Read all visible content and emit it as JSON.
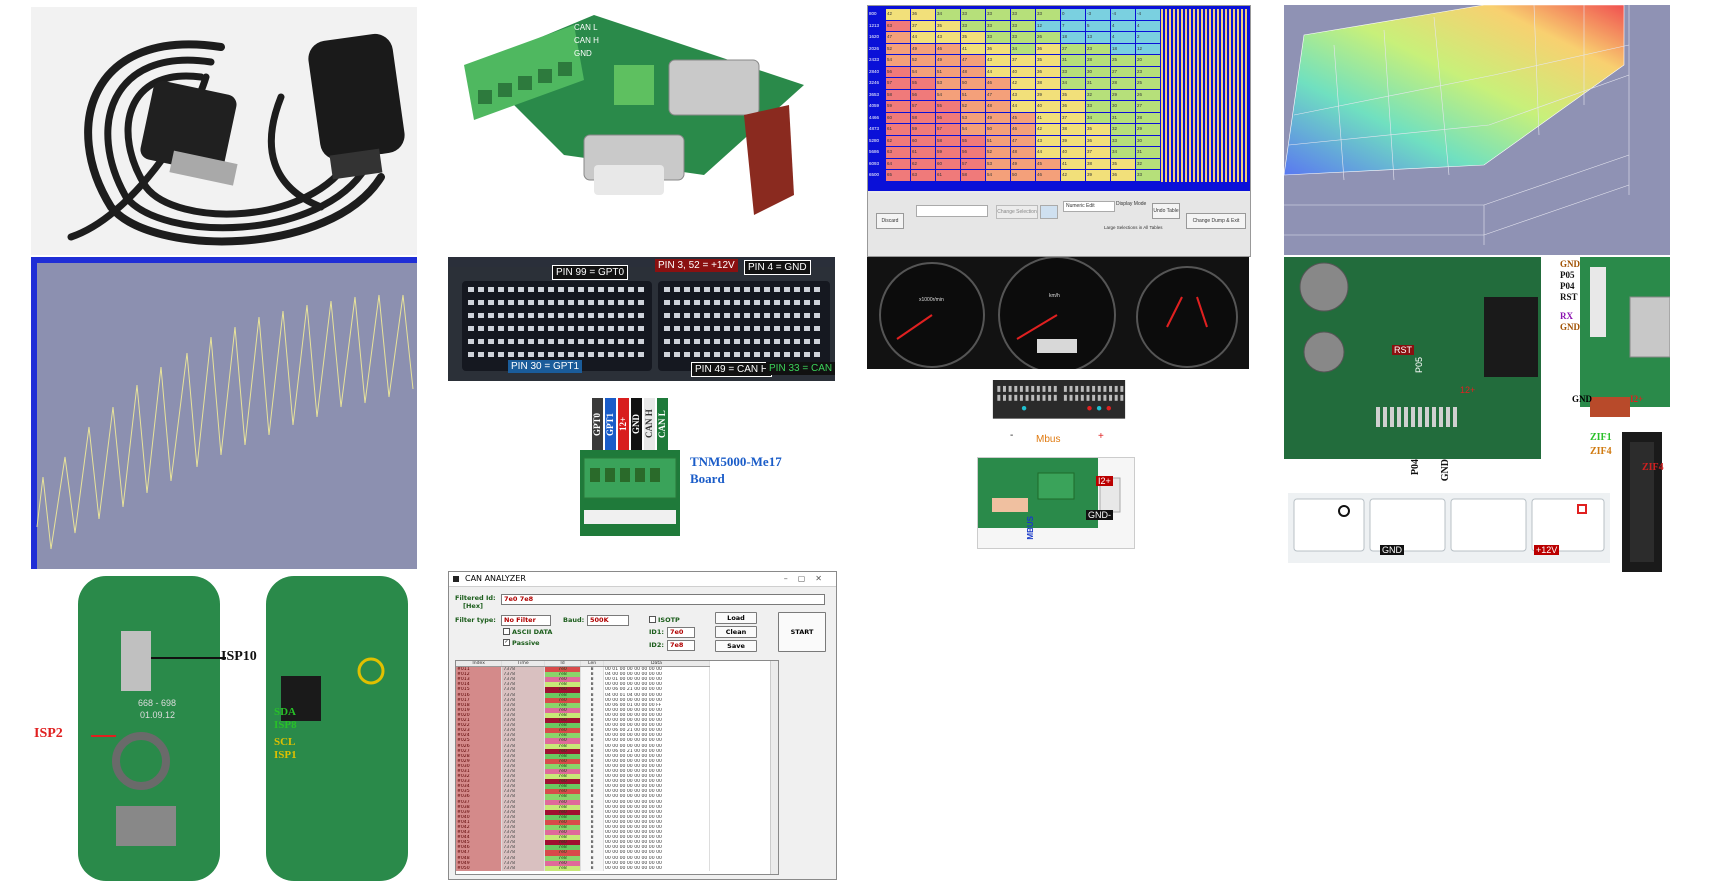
{
  "colors": {
    "pcb_green": "#1f7a3a",
    "terminal_green": "#3aa35a",
    "oscilloscope_bg": "#8c90b0",
    "oscilloscope_frame": "#1f2ed6",
    "oscilloscope_trace": "#e8e39a",
    "map_blue": "#0a10d8",
    "table_red": "#f07a7a",
    "table_yellow": "#f2e07a",
    "table_green": "#b6e07a",
    "accent_red": "#e02020",
    "accent_blue": "#1a5cc8"
  },
  "obd_cable": {
    "icon": "obd-cable-photo-icon"
  },
  "adapter_board": {
    "icon": "obd-db15-adapter-board-photo-icon"
  },
  "ecu_pinout": {
    "labels": {
      "gpt0": "PIN 99 = GPT0",
      "v12": "PIN 3, 52 = +12V",
      "gnd": "PIN 4 = GND",
      "gpt1": "PIN 30 = GPT1",
      "canh": "PIN 49 = CAN H",
      "canl": "PIN 33 = CAN L"
    }
  },
  "terminal_board": {
    "wires": [
      "GPT0",
      "GPT1",
      "12+",
      "GND",
      "CAN H",
      "CAN L"
    ],
    "caption_line1": "TNM5000-Me17",
    "caption_line2": "Board"
  },
  "map_table": {
    "row_headers": [
      "800",
      "1213",
      "1620",
      "2026",
      "2433",
      "2840",
      "3246",
      "3653",
      "4059",
      "4466",
      "4873",
      "5280",
      "5686",
      "6093",
      "6500"
    ],
    "rows": [
      [
        42,
        36,
        34,
        33,
        33,
        33,
        33,
        0,
        -3,
        -4,
        -4
      ],
      [
        63,
        37,
        35,
        33,
        33,
        33,
        12,
        7,
        5,
        4,
        4
      ],
      [
        47,
        44,
        43,
        35,
        33,
        33,
        26,
        18,
        13,
        4,
        2
      ],
      [
        52,
        49,
        46,
        41,
        36,
        34,
        36,
        27,
        23,
        18,
        12
      ],
      [
        54,
        52,
        49,
        47,
        43,
        37,
        35,
        31,
        28,
        25,
        20
      ],
      [
        56,
        54,
        51,
        48,
        44,
        40,
        36,
        33,
        30,
        27,
        23
      ],
      [
        57,
        55,
        53,
        50,
        46,
        42,
        38,
        34,
        31,
        28,
        25
      ],
      [
        58,
        56,
        54,
        51,
        47,
        43,
        39,
        35,
        32,
        29,
        26
      ],
      [
        59,
        57,
        55,
        52,
        48,
        44,
        40,
        36,
        33,
        30,
        27
      ],
      [
        60,
        58,
        56,
        53,
        49,
        45,
        41,
        37,
        34,
        31,
        28
      ],
      [
        61,
        59,
        57,
        54,
        50,
        46,
        42,
        38,
        35,
        32,
        29
      ],
      [
        62,
        60,
        58,
        55,
        51,
        47,
        43,
        39,
        36,
        33,
        30
      ],
      [
        63,
        61,
        59,
        56,
        52,
        48,
        44,
        40,
        37,
        34,
        31
      ],
      [
        64,
        62,
        60,
        57,
        53,
        49,
        45,
        41,
        38,
        35,
        32
      ],
      [
        65,
        63,
        61,
        58,
        54,
        50,
        46,
        42,
        39,
        36,
        33
      ]
    ],
    "toolbar": {
      "discard": "Discard",
      "change_selection": "Change Selection",
      "edit_mode": "Numeric Edit",
      "display_mode": "Display Mode",
      "undo": "Undo Table",
      "change_dump": "Change Dump & Exit",
      "selections_note": "Large Selections in All Tables"
    }
  },
  "map_3d": {
    "icon": "3d-fuel-map-surface-icon"
  },
  "oscilloscope": {
    "icon": "oscilloscope-sawtooth-trace-icon"
  },
  "instrument_cluster": {
    "icon": "instrument-cluster-gauges-icon",
    "tach_label": "x1000r/min",
    "speedo_label": "km/h",
    "tach_ticks": [
      "0",
      "1",
      "2",
      "3",
      "4",
      "5",
      "6",
      "7",
      "8"
    ],
    "speed_ticks": [
      "0",
      "20",
      "40",
      "60",
      "80",
      "100",
      "120",
      "140",
      "160"
    ]
  },
  "cluster_connector": {
    "mbus": "Mbus",
    "minus": "-",
    "plus": "+"
  },
  "cluster_board": {
    "i2_plus": "I2+",
    "gnd_minus": "GND-",
    "mbus": "MBUS"
  },
  "ecu_board_zif": {
    "pins_right": [
      "GND",
      "P05",
      "P04",
      "RST",
      "RX",
      "GND"
    ],
    "gnd": "GND",
    "i2plus": "I2+",
    "zif1": "ZIF1",
    "zif4_a": "ZIF4",
    "zif4_b": "ZIF4",
    "rst": "RST",
    "pos": "P05",
    "p04": "P04",
    "plus12": "12+",
    "connector_gnd": "GND",
    "connector_12v": "+12V"
  },
  "key_pcb": {
    "isp10": "ISP10",
    "isp2": "ISP2",
    "isp_labels": [
      "SDA",
      "ISP8",
      "SCL",
      "ISP1"
    ],
    "code": "668 - 698",
    "date": "01.09.12"
  },
  "can_analyzer": {
    "title": "CAN ANALYZER",
    "filtered_id_label": "Filtered Id:",
    "hex_label": "[Hex]",
    "filtered_id_value": "7e0 7e8",
    "filter_type_label": "Filter type:",
    "filter_type_value": "No Filter",
    "baud_label": "Baud:",
    "baud_value": "500K",
    "isotp": "ISOTP",
    "ascii": "ASCII DATA",
    "passive": "Passive",
    "id1_label": "ID1:",
    "id1_value": "7e0",
    "id2_label": "ID2:",
    "id2_value": "7e8",
    "load": "Load",
    "clean": "Clean",
    "save": "Save",
    "start": "START",
    "columns": [
      "Index",
      "Time",
      "Id",
      "Len",
      "Data"
    ],
    "rows": [
      [
        "#011",
        "7378",
        "7e0",
        "8",
        "00 01 00 00 00 00 00 00"
      ],
      [
        "#012",
        "7378",
        "7e8",
        "8",
        "04 00 00 00 00 00 00 00"
      ],
      [
        "#013",
        "7378",
        "7e0",
        "8",
        "00 01 00 00 00 00 00 00"
      ],
      [
        "#014",
        "7378",
        "7e8",
        "8",
        "00 00 00 00 00 00 00 00"
      ],
      [
        "#015",
        "7378",
        "7e0",
        "8",
        "00 06 00 21 00 00 00 00"
      ],
      [
        "#016",
        "7378",
        "7e8",
        "8",
        "04 00 01 04 00 00 00 00"
      ],
      [
        "#017",
        "7378",
        "7e0",
        "8",
        "00 00 00 00 00 00 00 00"
      ],
      [
        "#018",
        "7378",
        "7e8",
        "8",
        "00 06 00 01 00 00 00 FF"
      ],
      [
        "#019",
        "7378",
        "7e0",
        "8",
        "00 00 00 00 00 00 00 00"
      ],
      [
        "#020",
        "7378",
        "7e8",
        "8",
        "00 00 00 00 00 00 00 00"
      ],
      [
        "#021",
        "7378",
        "7e0",
        "8",
        "00 00 00 00 00 00 00 00"
      ],
      [
        "#022",
        "7378",
        "7e8",
        "8",
        "00 00 00 00 00 00 00 00"
      ],
      [
        "#023",
        "7378",
        "7e0",
        "8",
        "00 06 00 21 00 00 00 00"
      ],
      [
        "#024",
        "7378",
        "7e8",
        "8",
        "00 00 00 00 00 00 00 00"
      ],
      [
        "#025",
        "7378",
        "7e0",
        "8",
        "00 00 00 00 00 00 00 00"
      ],
      [
        "#026",
        "7378",
        "7e8",
        "8",
        "00 00 00 00 00 00 00 00"
      ],
      [
        "#027",
        "7378",
        "7e0",
        "8",
        "00 06 00 21 00 00 00 00"
      ],
      [
        "#028",
        "7378",
        "7e8",
        "8",
        "00 00 00 00 00 00 00 00"
      ],
      [
        "#029",
        "7378",
        "7e0",
        "8",
        "00 00 00 00 00 00 00 00"
      ],
      [
        "#030",
        "7378",
        "7e8",
        "8",
        "00 00 00 00 00 00 00 00"
      ],
      [
        "#031",
        "7378",
        "7e0",
        "8",
        "00 00 00 00 00 00 00 00"
      ],
      [
        "#032",
        "7378",
        "7e8",
        "8",
        "00 00 00 00 00 00 00 00"
      ],
      [
        "#033",
        "7378",
        "7e0",
        "8",
        "00 00 00 00 00 00 00 00"
      ],
      [
        "#034",
        "7378",
        "7e8",
        "8",
        "00 00 00 00 00 00 00 00"
      ],
      [
        "#035",
        "7378",
        "7e0",
        "8",
        "00 00 00 00 00 00 00 00"
      ],
      [
        "#036",
        "7378",
        "7e8",
        "8",
        "00 00 00 00 00 00 00 00"
      ],
      [
        "#037",
        "7378",
        "7e0",
        "8",
        "00 00 00 00 00 00 00 00"
      ],
      [
        "#038",
        "7378",
        "7e8",
        "8",
        "00 00 00 00 00 00 00 00"
      ],
      [
        "#039",
        "7378",
        "7e0",
        "8",
        "00 00 00 00 00 00 00 00"
      ],
      [
        "#040",
        "7378",
        "7e8",
        "8",
        "00 00 00 00 00 00 00 00"
      ],
      [
        "#041",
        "7378",
        "7e0",
        "8",
        "00 00 00 00 00 00 00 00"
      ],
      [
        "#042",
        "7378",
        "7e8",
        "8",
        "00 00 00 00 00 00 00 00"
      ],
      [
        "#043",
        "7378",
        "7e0",
        "8",
        "00 00 00 00 00 00 00 00"
      ],
      [
        "#044",
        "7378",
        "7e8",
        "8",
        "00 00 00 00 00 00 00 00"
      ],
      [
        "#045",
        "7378",
        "7e0",
        "8",
        "00 00 00 00 00 00 00 00"
      ],
      [
        "#046",
        "7378",
        "7e8",
        "8",
        "00 00 00 00 00 00 00 00"
      ],
      [
        "#047",
        "7378",
        "7e0",
        "8",
        "00 00 00 00 00 00 00 00"
      ],
      [
        "#048",
        "7378",
        "7e8",
        "8",
        "00 00 00 00 00 00 00 00"
      ],
      [
        "#049",
        "7378",
        "7e0",
        "8",
        "00 00 00 00 00 00 00 00"
      ],
      [
        "#050",
        "7378",
        "7e8",
        "8",
        "00 00 00 00 00 00 00 00"
      ]
    ]
  }
}
